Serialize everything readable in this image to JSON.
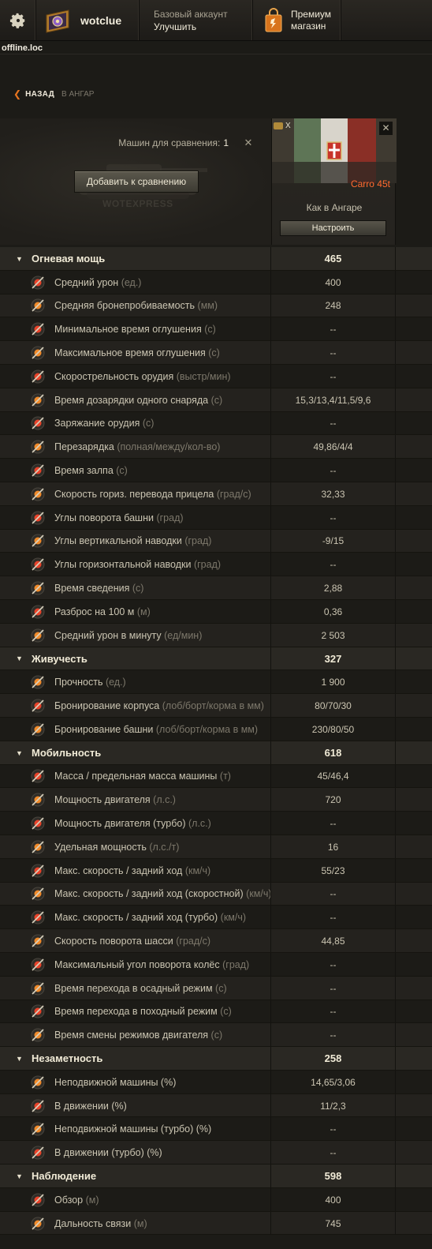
{
  "topbar": {
    "username": "wotclue",
    "account_line1": "Базовый аккаунт",
    "account_line2": "Улучшить",
    "premium_line1": "Премиум",
    "premium_line2": "магазин"
  },
  "host": "offline.loc",
  "nav": {
    "back": "НАЗАД",
    "crumb": "В АНГАР"
  },
  "compare": {
    "count_label": "Машин для сравнения:",
    "count_value": "1",
    "add_button": "Добавить к сравнению",
    "watermark": "WOTEXPRESS",
    "vehicle": {
      "tier": "X",
      "name": "Carro 45t",
      "state": "Как в Ангаре",
      "configure_button": "Настроить"
    }
  },
  "sections": [
    {
      "title": "Огневая мощь",
      "value": "465",
      "rows": [
        {
          "label": "Средний урон",
          "unit": "(ед.)",
          "value": "400",
          "icon": "damage-icon"
        },
        {
          "label": "Средняя бронепробиваемость",
          "unit": "(мм)",
          "value": "248",
          "icon": "penetration-icon"
        },
        {
          "label": "Минимальное время оглушения",
          "unit": "(с)",
          "value": "--",
          "icon": "stun-min-icon"
        },
        {
          "label": "Максимальное время оглушения",
          "unit": "(с)",
          "value": "--",
          "icon": "stun-max-icon"
        },
        {
          "label": "Скорострельность орудия",
          "unit": "(выстр/мин)",
          "value": "--",
          "icon": "rate-of-fire-icon"
        },
        {
          "label": "Время дозарядки одного снаряда",
          "unit": "(с)",
          "value": "15,3/13,4/11,5/9,6",
          "icon": "shell-reload-icon"
        },
        {
          "label": "Заряжание орудия",
          "unit": "(с)",
          "value": "--",
          "icon": "loading-icon"
        },
        {
          "label": "Перезарядка",
          "unit": "(полная/между/кол-во)",
          "value": "49,86/4/4",
          "icon": "magazine-reload-icon"
        },
        {
          "label": "Время залпа",
          "unit": "(с)",
          "value": "--",
          "icon": "salvo-icon"
        },
        {
          "label": "Скорость гориз. перевода прицела",
          "unit": "(град/с)",
          "value": "32,33",
          "icon": "traverse-speed-icon"
        },
        {
          "label": "Углы поворота башни",
          "unit": "(град)",
          "value": "--",
          "icon": "turret-angles-icon"
        },
        {
          "label": "Углы вертикальной наводки",
          "unit": "(град)",
          "value": "-9/15",
          "icon": "elevation-icon"
        },
        {
          "label": "Углы горизонтальной наводки",
          "unit": "(град)",
          "value": "--",
          "icon": "horizontal-aim-icon"
        },
        {
          "label": "Время сведения",
          "unit": "(с)",
          "value": "2,88",
          "icon": "aim-time-icon"
        },
        {
          "label": "Разброс на 100 м",
          "unit": "(м)",
          "value": "0,36",
          "icon": "dispersion-icon"
        },
        {
          "label": "Средний урон в минуту",
          "unit": "(ед/мин)",
          "value": "2 503",
          "icon": "dpm-icon"
        }
      ]
    },
    {
      "title": "Живучесть",
      "value": "327",
      "rows": [
        {
          "label": "Прочность",
          "unit": "(ед.)",
          "value": "1 900",
          "icon": "hitpoints-icon"
        },
        {
          "label": "Бронирование корпуса",
          "unit": "(лоб/борт/корма в мм)",
          "value": "80/70/30",
          "icon": "hull-armor-icon"
        },
        {
          "label": "Бронирование башни",
          "unit": "(лоб/борт/корма в мм)",
          "value": "230/80/50",
          "icon": "turret-armor-icon"
        }
      ]
    },
    {
      "title": "Мобильность",
      "value": "618",
      "rows": [
        {
          "label": "Масса / предельная масса машины",
          "unit": "(т)",
          "value": "45/46,4",
          "icon": "weight-icon"
        },
        {
          "label": "Мощность двигателя",
          "unit": "(л.с.)",
          "value": "720",
          "icon": "engine-power-icon"
        },
        {
          "label": "Мощность двигателя (турбо)",
          "unit": "(л.с.)",
          "value": "--",
          "icon": "engine-turbo-icon"
        },
        {
          "label": "Удельная мощность",
          "unit": "(л.с./т)",
          "value": "16",
          "icon": "specific-power-icon"
        },
        {
          "label": "Макс. скорость / задний ход",
          "unit": "(км/ч)",
          "value": "55/23",
          "icon": "speed-icon"
        },
        {
          "label": "Макс. скорость / задний ход (скоростной)",
          "unit": "(км/ч)",
          "value": "--",
          "icon": "speed-fast-icon"
        },
        {
          "label": "Макс. скорость / задний ход (турбо)",
          "unit": "(км/ч)",
          "value": "--",
          "icon": "speed-turbo-icon"
        },
        {
          "label": "Скорость поворота шасси",
          "unit": "(град/с)",
          "value": "44,85",
          "icon": "hull-traverse-icon"
        },
        {
          "label": "Максимальный угол поворота колёс",
          "unit": "(град)",
          "value": "--",
          "icon": "wheel-angle-icon"
        },
        {
          "label": "Время перехода в осадный режим",
          "unit": "(с)",
          "value": "--",
          "icon": "siege-mode-icon"
        },
        {
          "label": "Время перехода в походный режим",
          "unit": "(с)",
          "value": "--",
          "icon": "travel-mode-icon"
        },
        {
          "label": "Время смены режимов двигателя",
          "unit": "(с)",
          "value": "--",
          "icon": "engine-mode-icon"
        }
      ]
    },
    {
      "title": "Незаметность",
      "value": "258",
      "rows": [
        {
          "label": "Неподвижной машины (%)",
          "unit": "",
          "value": "14,65/3,06",
          "icon": "camo-still-icon"
        },
        {
          "label": "В движении (%)",
          "unit": "",
          "value": "11/2,3",
          "icon": "camo-moving-icon"
        },
        {
          "label": "Неподвижной машины (турбо) (%)",
          "unit": "",
          "value": "--",
          "icon": "camo-still-turbo-icon"
        },
        {
          "label": "В движении (турбо) (%)",
          "unit": "",
          "value": "--",
          "icon": "camo-moving-turbo-icon"
        }
      ]
    },
    {
      "title": "Наблюдение",
      "value": "598",
      "rows": [
        {
          "label": "Обзор",
          "unit": "(м)",
          "value": "400",
          "icon": "view-range-icon"
        },
        {
          "label": "Дальность связи",
          "unit": "(м)",
          "value": "745",
          "icon": "radio-range-icon"
        }
      ]
    }
  ]
}
